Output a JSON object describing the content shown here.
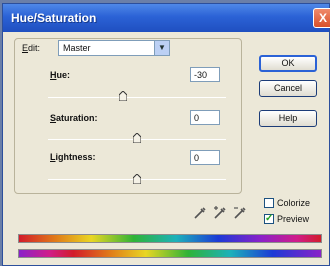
{
  "dialog": {
    "title": "Hue/Saturation",
    "close_glyph": "X"
  },
  "edit": {
    "label_prefix": "E",
    "label_rest": "dit:",
    "value": "Master"
  },
  "hue": {
    "label_prefix": "H",
    "label_rest": "ue:",
    "value": "-30",
    "slider_fraction": 0.42
  },
  "saturation": {
    "label_prefix": "S",
    "label_rest": "aturation:",
    "value": "0",
    "slider_fraction": 0.5
  },
  "lightness": {
    "label_prefix": "L",
    "label_rest": "ightness:",
    "value": "0",
    "slider_fraction": 0.5
  },
  "buttons": {
    "ok": "OK",
    "cancel": "Cancel",
    "help": "Help"
  },
  "options": {
    "colorize_label": "Colorize",
    "colorize_checked": false,
    "preview_label": "Preview",
    "preview_checked": true
  },
  "icons": [
    "eyedropper-icon",
    "eyedropper-plus-icon",
    "eyedropper-minus-icon"
  ]
}
